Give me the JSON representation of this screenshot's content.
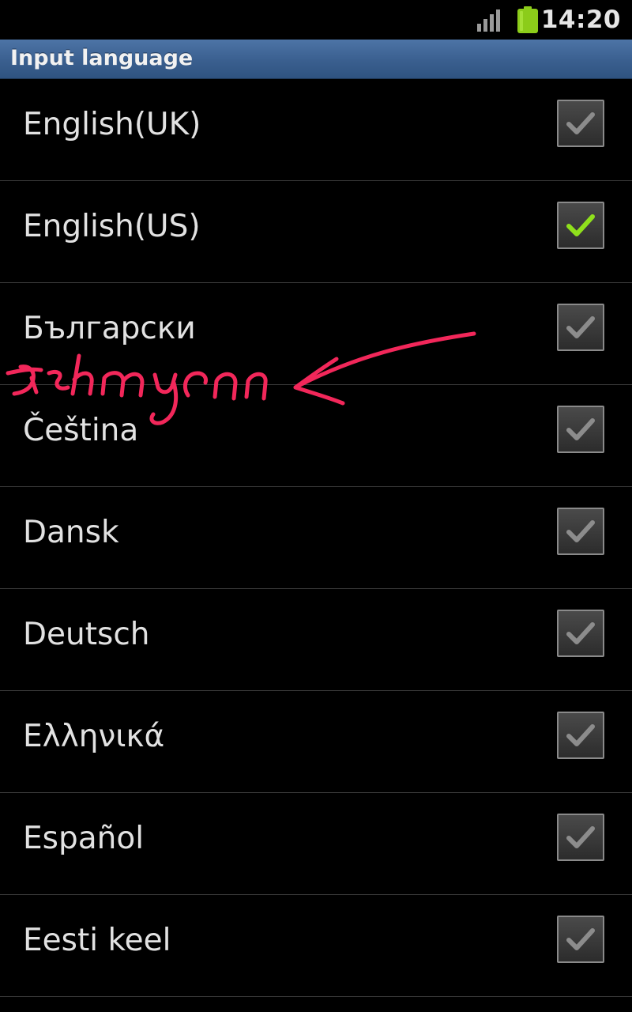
{
  "status_bar": {
    "time": "14:20",
    "icons": [
      "signal-strength-icon",
      "battery-icon"
    ],
    "battery_color": "#8ccc1a"
  },
  "title_bar": {
    "title": "Input language"
  },
  "colors": {
    "title_bar_blue": "#3a5f8f",
    "check_active": "#8fe01c",
    "check_inactive": "#8c8c8c",
    "annotation_pink": "#f2275a"
  },
  "languages": [
    {
      "label": "English(UK)",
      "checked": true,
      "highlighted": false
    },
    {
      "label": "English(US)",
      "checked": true,
      "highlighted": true
    },
    {
      "label": "Български",
      "checked": true,
      "highlighted": false
    },
    {
      "label": "Čeština",
      "checked": true,
      "highlighted": false
    },
    {
      "label": "Dansk",
      "checked": true,
      "highlighted": false
    },
    {
      "label": "Deutsch",
      "checked": true,
      "highlighted": false
    },
    {
      "label": "Ελληνικά",
      "checked": true,
      "highlighted": false
    },
    {
      "label": "Español",
      "checked": true,
      "highlighted": false
    },
    {
      "label": "Eesti keel",
      "checked": true,
      "highlighted": false
    }
  ]
}
